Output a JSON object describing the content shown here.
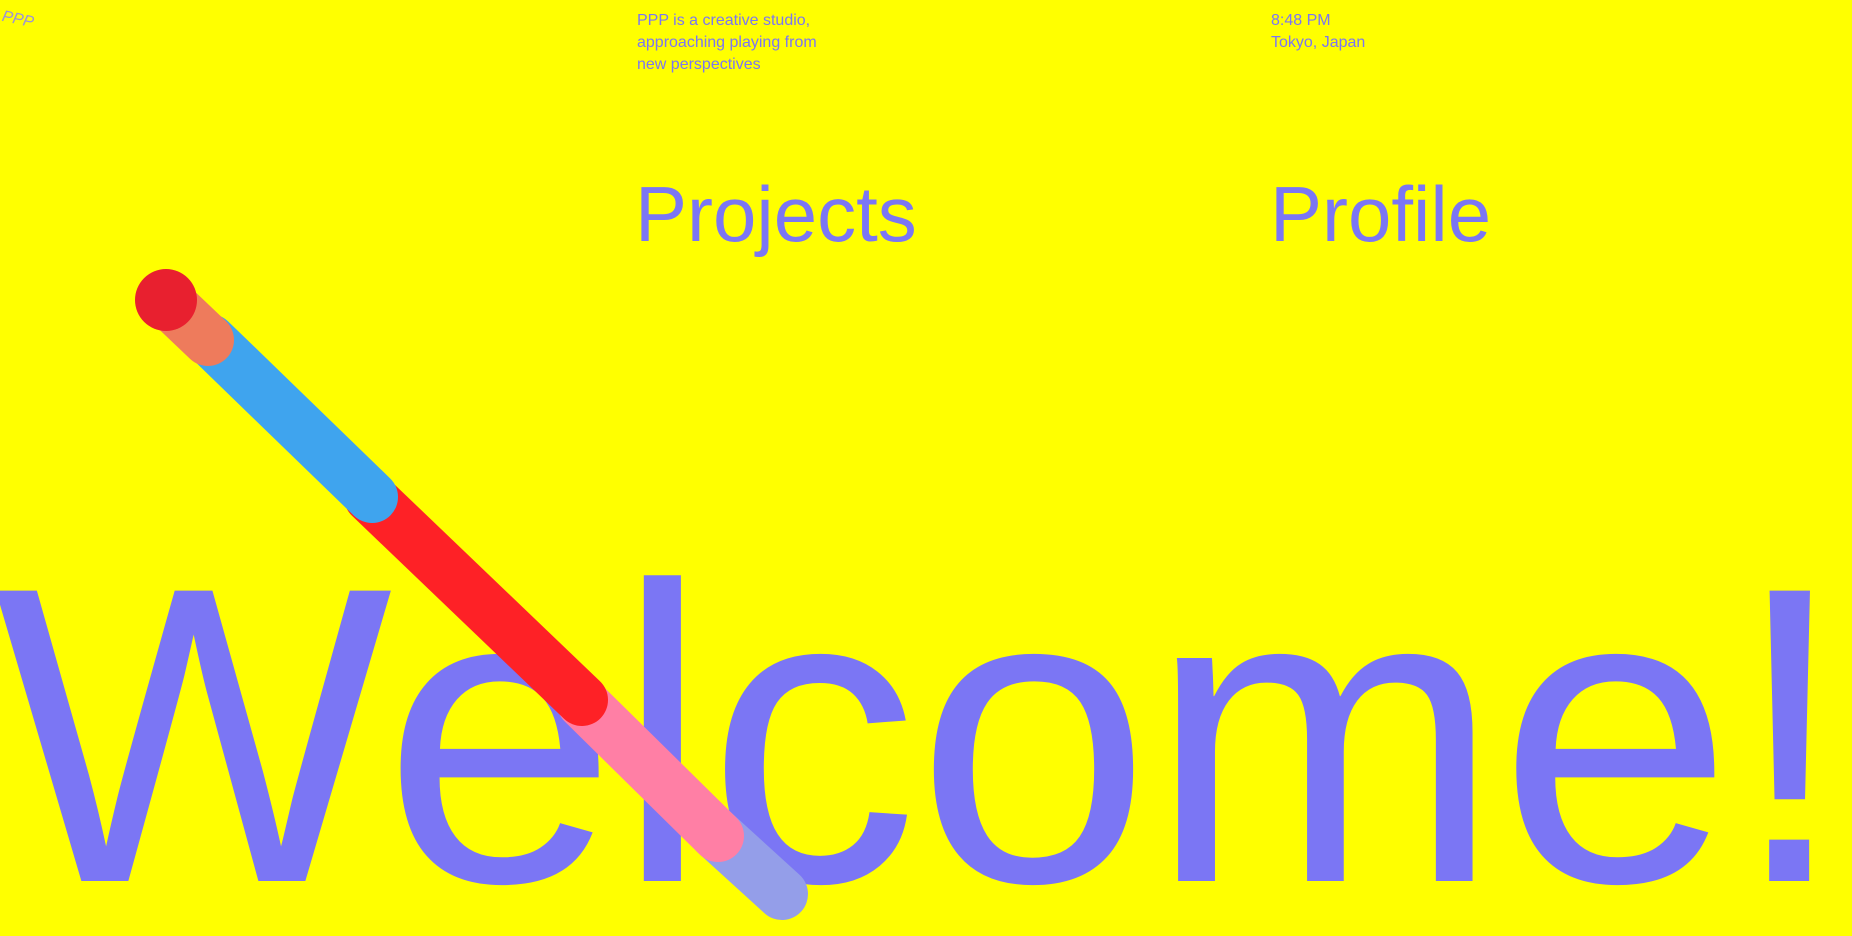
{
  "site": {
    "logo_text": "PPP",
    "tagline": "PPP is a creative studio, approaching playing from new perspectives",
    "time": "8:48 PM",
    "location": "Tokyo, Japan"
  },
  "nav": {
    "projects_label": "Projects",
    "profile_label": "Profile"
  },
  "hero": {
    "headline": "Welcome!"
  },
  "colors": {
    "background": "#ffff00",
    "text": "#7b76f4",
    "stick_segments": [
      "#e8202f",
      "#ee7b5c",
      "#3fa4ee",
      "#fe2126",
      "#ff7fa5",
      "#949ee9"
    ]
  }
}
